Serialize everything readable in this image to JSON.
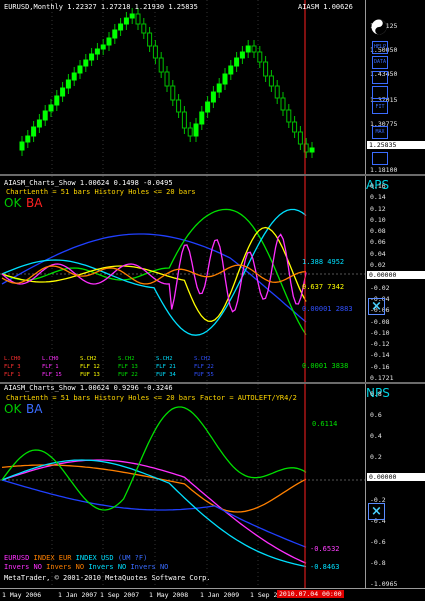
{
  "price_panel": {
    "header": "EURUSD,Monthly  1.22327 1.27218 1.21930 1.25835",
    "indicator_title": "AIASM 1.00626",
    "yin_yang_icon": "yin-yang",
    "price_ticks": [
      "1.56125",
      "1.50050",
      "1.43450",
      "1.37015",
      "1.30775",
      "1.25835",
      "1.18100"
    ],
    "current_price": "1.25835",
    "buttons": [
      "HELP",
      "DATA",
      "",
      "",
      "FIT",
      "MAX",
      ""
    ],
    "colors": {
      "bull": "#00ff00",
      "bear": "#00b000",
      "red_line": "#ff2020"
    }
  },
  "aps_panel": {
    "header": "AIASM_Charts_Show 1.00624 0.1498 -0.0495",
    "params": "ChartLenth = 51 bars    History Holes <= 20 bars",
    "ok": "OK",
    "ba": "BA",
    "name": "APS",
    "y_ticks": [
      "0.16",
      "0.14",
      "0.12",
      "0.10",
      "0.08",
      "0.06",
      "0.04",
      "0.02",
      "0.00",
      "-0.02",
      "-0.04",
      "-0.06",
      "-0.08",
      "-0.10",
      "-0.12",
      "-0.14",
      "-0.16",
      "0.1721"
    ],
    "zero_label": "0.00000",
    "series_labels": [
      "1.388 4952",
      "0.637 7342",
      "0.00001 2883",
      "0.0001 3838"
    ],
    "legend_rows": [
      [
        "L.CH0",
        "L.CH0",
        "S.CH2",
        "S.CH2",
        "S.CH2",
        "S.CH2"
      ],
      [
        "FLF 3",
        "FLF 1",
        "FLF 12",
        "FLF 13",
        "FLF 21",
        "FLF 22"
      ],
      [
        "FLF 1",
        "FLF 15",
        "FUF 13",
        "FUF 22",
        "FUF 34",
        "FUF 55"
      ]
    ],
    "close_icon": "close-icon"
  },
  "nps_panel": {
    "header": "AIASM_Charts_Show 1.00624 0.9296 -0.3246",
    "params": "ChartLenth = 51 bars    History Holes <= 20 bars    Factor = AUTOLEFT/YR4/2",
    "ok": "OK",
    "ba": "BA",
    "name": "NPS",
    "y_ticks": [
      "0.8",
      "0.6",
      "0.4",
      "0.2",
      "0.00",
      "-0.2",
      "-0.4",
      "-0.6",
      "-0.8",
      "-1.0965"
    ],
    "zero_label": "0.00000",
    "series_labels": [
      "0.6114",
      "-0.6532",
      "-0.8463"
    ],
    "legend_row1": [
      "EURUSD",
      "INDEX EUR",
      "INDEX USD",
      "(UM ?F)"
    ],
    "legend_row2": [
      "Invers NO",
      "Invers NO",
      "Invers NO",
      "Invers NO"
    ],
    "copyright": "MetaTrader, © 2001-2010 MetaQuotes Software Corp.",
    "close_icon": "close-icon"
  },
  "time_axis": {
    "labels": [
      "1 May 2006",
      "1 Jan 2007",
      "1 Sep 2007",
      "1 May 2008",
      "1 Jan 2009",
      "1 Sep 200"
    ],
    "marker": "2010.07.04 00:00"
  }
}
